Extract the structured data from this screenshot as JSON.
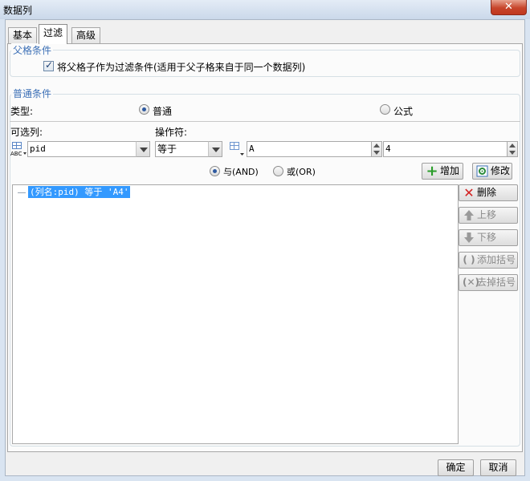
{
  "window": {
    "title": "数据列",
    "close_glyph": "✕"
  },
  "tabs": [
    {
      "label": "基本",
      "active": false
    },
    {
      "label": "过滤",
      "active": true
    },
    {
      "label": "高级",
      "active": false
    }
  ],
  "parent_group": {
    "legend": "父格条件",
    "checkbox_label": "将父格子作为过滤条件(适用于父子格来自于同一个数据列)",
    "checked": true
  },
  "common_group": {
    "legend": "普通条件",
    "type_label": "类型:",
    "type_options": [
      {
        "label": "普通",
        "selected": true
      },
      {
        "label": "公式",
        "selected": false
      }
    ],
    "column_label": "可选列:",
    "operator_label": "操作符:",
    "column_value": "pid",
    "operator_value": "等于",
    "value_a": "A",
    "value_b": "4",
    "logic_options": [
      {
        "label": "与(AND)",
        "selected": true
      },
      {
        "label": "或(OR)",
        "selected": false
      }
    ],
    "add_button": "增加",
    "modify_button": "修改"
  },
  "conditions": [
    {
      "text": "(列名:pid) 等于 'A4'",
      "selected": true
    }
  ],
  "side_buttons": [
    {
      "label": "删除",
      "icon": "delete-x-icon",
      "enabled": true
    },
    {
      "label": "上移",
      "icon": "arrow-up-icon",
      "enabled": false
    },
    {
      "label": "下移",
      "icon": "arrow-down-icon",
      "enabled": false
    },
    {
      "label": "添加括号",
      "icon": "add-parentheses-icon",
      "enabled": false
    },
    {
      "label": "去掉括号",
      "icon": "remove-parentheses-icon",
      "enabled": false
    }
  ],
  "footer": {
    "ok": "确定",
    "cancel": "取消"
  },
  "colors": {
    "accent": "#3b6fb6",
    "selection": "#3399ff",
    "close": "#c7452b",
    "add_icon": "#2a9d2a",
    "delete_icon": "#d21f1f"
  }
}
